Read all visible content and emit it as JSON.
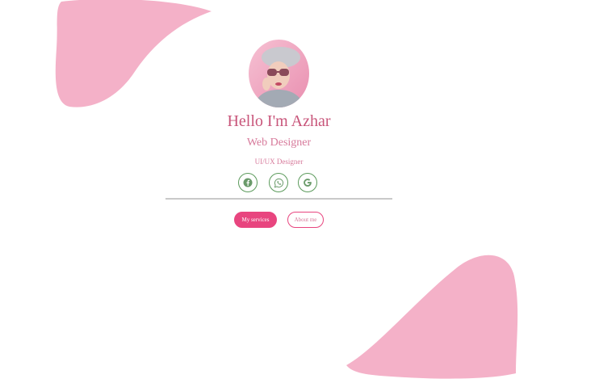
{
  "profile": {
    "greeting": "Hello I'm Azhar",
    "title": "Web Designer",
    "subtitle": "UI/UX Designer",
    "avatar": "avatar-photo"
  },
  "social": [
    {
      "icon": "facebook-icon"
    },
    {
      "icon": "whatsapp-icon"
    },
    {
      "icon": "google-icon"
    }
  ],
  "buttons": {
    "primary_label": "My services",
    "secondary_label": "About me"
  },
  "colors": {
    "accent": "#e8457f",
    "heading": "#c8557a",
    "text": "#d77a9b",
    "icon_border": "#5b9a5b",
    "blob": "#f4b1c8"
  }
}
